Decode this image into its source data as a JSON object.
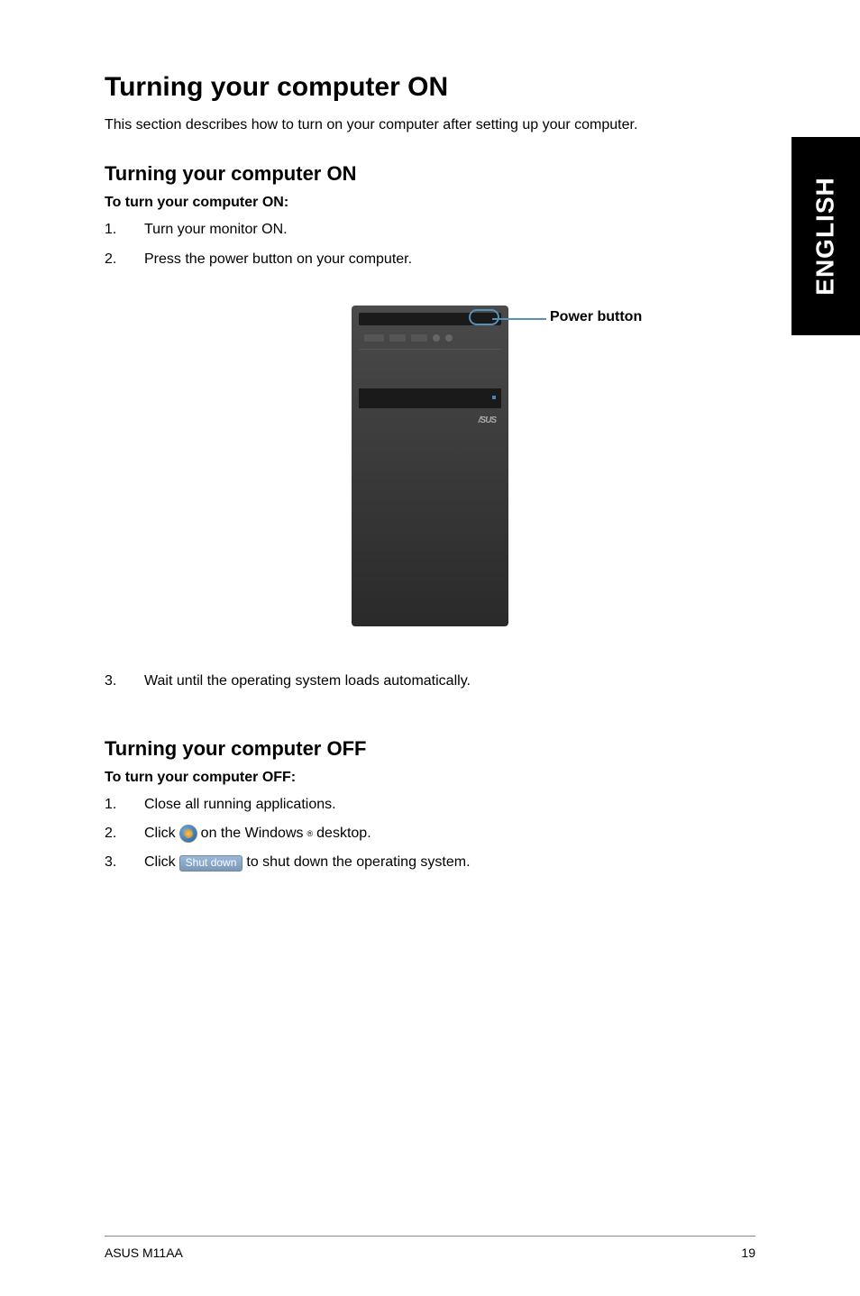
{
  "side_tab": "ENGLISH",
  "main_heading": "Turning your computer ON",
  "intro_text": "This section describes how to turn on your computer after setting up your computer.",
  "section_on": {
    "heading": "Turning your computer ON",
    "subheading": "To turn your computer ON:",
    "steps": [
      {
        "num": "1.",
        "text": "Turn your monitor ON."
      },
      {
        "num": "2.",
        "text": "Press the power button on your computer."
      },
      {
        "num": "3.",
        "text": "Wait until the operating system loads automatically."
      }
    ]
  },
  "figure": {
    "power_button_label": "Power button",
    "logo_text": "/SUS"
  },
  "section_off": {
    "heading": "Turning your computer OFF",
    "subheading": "To turn your computer OFF:",
    "steps": [
      {
        "num": "1.",
        "text": "Close all running applications."
      },
      {
        "num": "2.",
        "prefix": "Click",
        "suffix_a": "on the Windows",
        "reg": "®",
        "suffix_b": "desktop."
      },
      {
        "num": "3.",
        "prefix": "Click",
        "button_label": "Shut down",
        "suffix": "to shut down the operating system."
      }
    ]
  },
  "footer": {
    "left": "ASUS M11AA",
    "right": "19"
  }
}
